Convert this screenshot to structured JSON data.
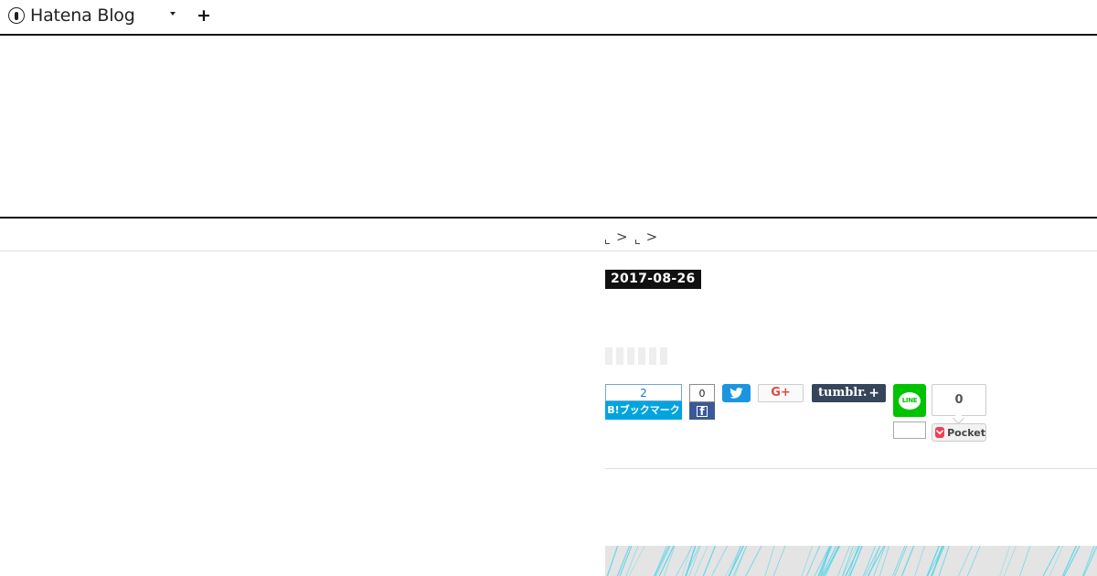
{
  "navbar": {
    "brand": "Hatena Blog",
    "menu_icon": "chevron-down-icon",
    "add_icon": "plus-icon"
  },
  "breadcrumb": {
    "items": [
      "",
      ""
    ],
    "separator": ">"
  },
  "article": {
    "date": "2017-08-26"
  },
  "share": {
    "hatena": {
      "count": "2",
      "label": "B!ブックマーク"
    },
    "facebook": {
      "count": "0",
      "icon": "facebook-icon"
    },
    "twitter": {
      "icon": "twitter-icon"
    },
    "google_plus": {
      "label": "G+"
    },
    "tumblr": {
      "label": "tumblr.",
      "plus": "+"
    },
    "line": {
      "label": "LINE",
      "count": ""
    },
    "pocket": {
      "count": "0",
      "label": "Pocket"
    }
  },
  "colors": {
    "hatena": "#00a4de",
    "facebook": "#3b5998",
    "twitter": "#1b95e0",
    "google_plus": "#dc4e41",
    "tumblr": "#35465c",
    "line": "#00c300",
    "pocket": "#ef4056",
    "date_badge": "#111111",
    "banner_line": "#4fd3ea"
  }
}
